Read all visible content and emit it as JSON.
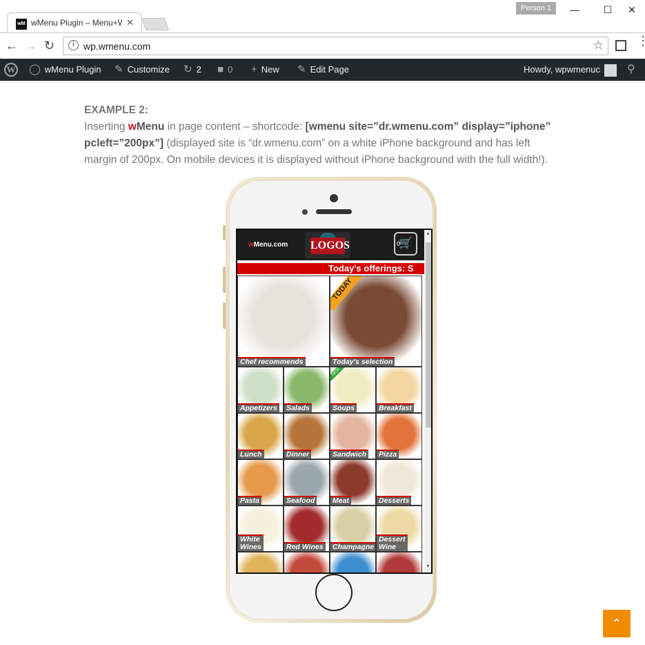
{
  "browser": {
    "tab_title": "wMenu Plugin – Menu+W",
    "tab_close": "✕",
    "favicon_text": "wM",
    "person_label": "Person 1",
    "url": "wp.wmenu.com",
    "win_minimize": "—",
    "win_maximize": "☐",
    "win_close": "✕"
  },
  "adminbar": {
    "site_name": "wMenu Plugin",
    "customize": "Customize",
    "updates_count": "2",
    "comments_count": "0",
    "new": "New",
    "edit_page": "Edit Page",
    "howdy": "Howdy, wpwmenuc"
  },
  "content": {
    "heading": "EXAMPLE 2:",
    "line_prefix": "Inserting ",
    "brand_w": "w",
    "brand_menu": "Menu",
    "line_mid": " in page content – shortcode: ",
    "shortcode": "[wmenu site=”dr.wmenu.com” display=”iphone” pcleft=”200px”]",
    "line_tail": " (displayed site is “dr.wmenu.com” on a white iPhone background and has left margin of 200px. On mobile devices it is displayed without iPhone background with the full width!)."
  },
  "phone_screen": {
    "brand_w": "w",
    "brand_rest": "Menu.com",
    "logo_text": "LOGOS",
    "cart_count": "0",
    "ticker": "Today's offerings: S",
    "today_tag": "TODAY",
    "new_tag": "NEW",
    "tiles": [
      {
        "label": "Chef recommends",
        "color": "#e8e2dc"
      },
      {
        "label": "Today's selection",
        "color": "#7a4b34"
      },
      {
        "label": "Appetizers",
        "color": "#cfe0c8"
      },
      {
        "label": "Salads",
        "color": "#8ab86a"
      },
      {
        "label": "Soups",
        "color": "#f1ecc2"
      },
      {
        "label": "Breakfast",
        "color": "#f3d6a0"
      },
      {
        "label": "Lunch",
        "color": "#d9a64b"
      },
      {
        "label": "Dinner",
        "color": "#b7753a"
      },
      {
        "label": "Sandwich",
        "color": "#e3b5a0"
      },
      {
        "label": "Pizza",
        "color": "#e2733a"
      },
      {
        "label": "Pasta",
        "color": "#e79a4a"
      },
      {
        "label": "Seafood",
        "color": "#9aa7ad"
      },
      {
        "label": "Meat",
        "color": "#8b3a2c"
      },
      {
        "label": "Desserts",
        "color": "#f1e7d8"
      },
      {
        "label": "White\nWines",
        "color": "#f6f0dc"
      },
      {
        "label": "Red Wines",
        "color": "#a32b2b"
      },
      {
        "label": "Champagne",
        "color": "#d9cfa4"
      },
      {
        "label": "Dessert\nWine",
        "color": "#eed9a4"
      },
      {
        "label": "",
        "color": "#e0b45a"
      },
      {
        "label": "",
        "color": "#c44a3a"
      },
      {
        "label": "",
        "color": "#3b8fd1"
      },
      {
        "label": "",
        "color": "#b33a3a"
      }
    ]
  },
  "colors": {
    "adminbar_bg": "#23282d",
    "ticker_red": "#d50000",
    "to_top_orange": "#f28b00",
    "brand_red": "#c8102e"
  }
}
